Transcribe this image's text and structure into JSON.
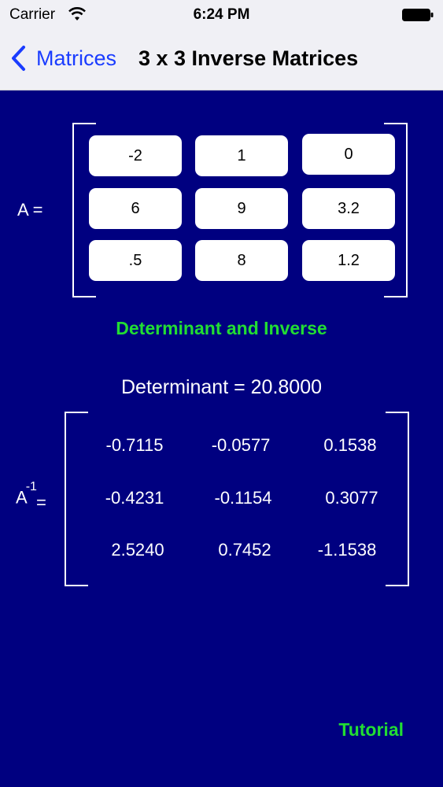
{
  "status_bar": {
    "carrier": "Carrier",
    "time": "6:24 PM",
    "wifi_icon": "wifi-icon",
    "battery_icon": "battery-icon"
  },
  "nav": {
    "back_label": "Matrices",
    "title": "3 x 3 Inverse Matrices"
  },
  "matrix_a": {
    "label": "A  =",
    "rows": [
      [
        "-2",
        "1",
        "0"
      ],
      [
        "6",
        "9",
        "3.2"
      ],
      [
        ".5",
        "8",
        "1.2"
      ]
    ]
  },
  "action": {
    "determinant_button": "Determinant and Inverse",
    "tutorial_button": "Tutorial"
  },
  "result": {
    "determinant_text": "Determinant = 20.8000",
    "inverse_label": "A",
    "inverse_superscript": "-1",
    "inverse_eq": "=",
    "inverse_rows": [
      [
        "-0.7115",
        "-0.0577",
        "0.1538"
      ],
      [
        "-0.4231",
        "-0.1154",
        "0.3077"
      ],
      [
        "2.5240",
        "0.7452",
        "-1.1538"
      ]
    ]
  },
  "colors": {
    "background": "#000080",
    "accent_green": "#22dd33",
    "nav_blue": "#1a3cff"
  }
}
